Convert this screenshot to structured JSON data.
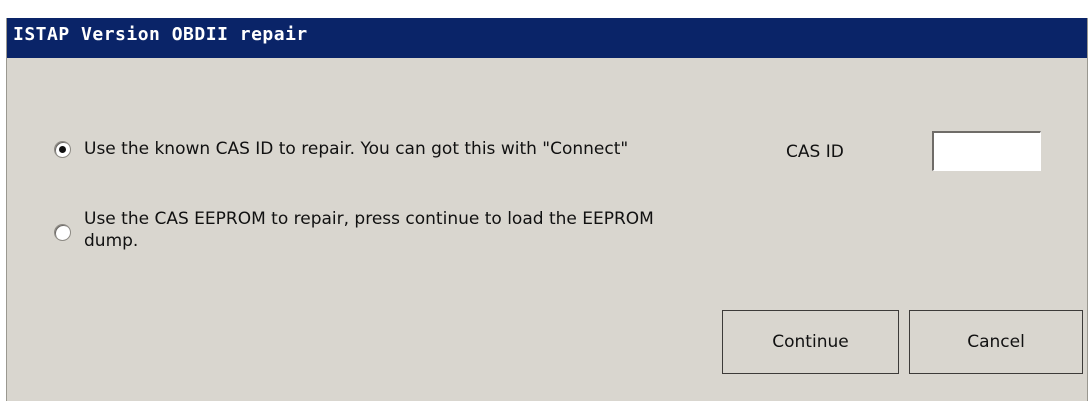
{
  "window": {
    "title": "ISTAP Version OBDII repair"
  },
  "options": [
    {
      "label": "Use the known CAS ID to repair. You can got this with \"Connect\"",
      "selected": true
    },
    {
      "label_line1": "Use the CAS EEPROM to repair, press continue to load the EEPROM",
      "label_line2": "dump.",
      "selected": false
    }
  ],
  "cas_id": {
    "label": "CAS ID",
    "value": ""
  },
  "buttons": {
    "continue_label": "Continue",
    "cancel_label": "Cancel"
  },
  "colors": {
    "titlebar": "#0a2468",
    "dialog_bg": "#d9d6cf"
  }
}
